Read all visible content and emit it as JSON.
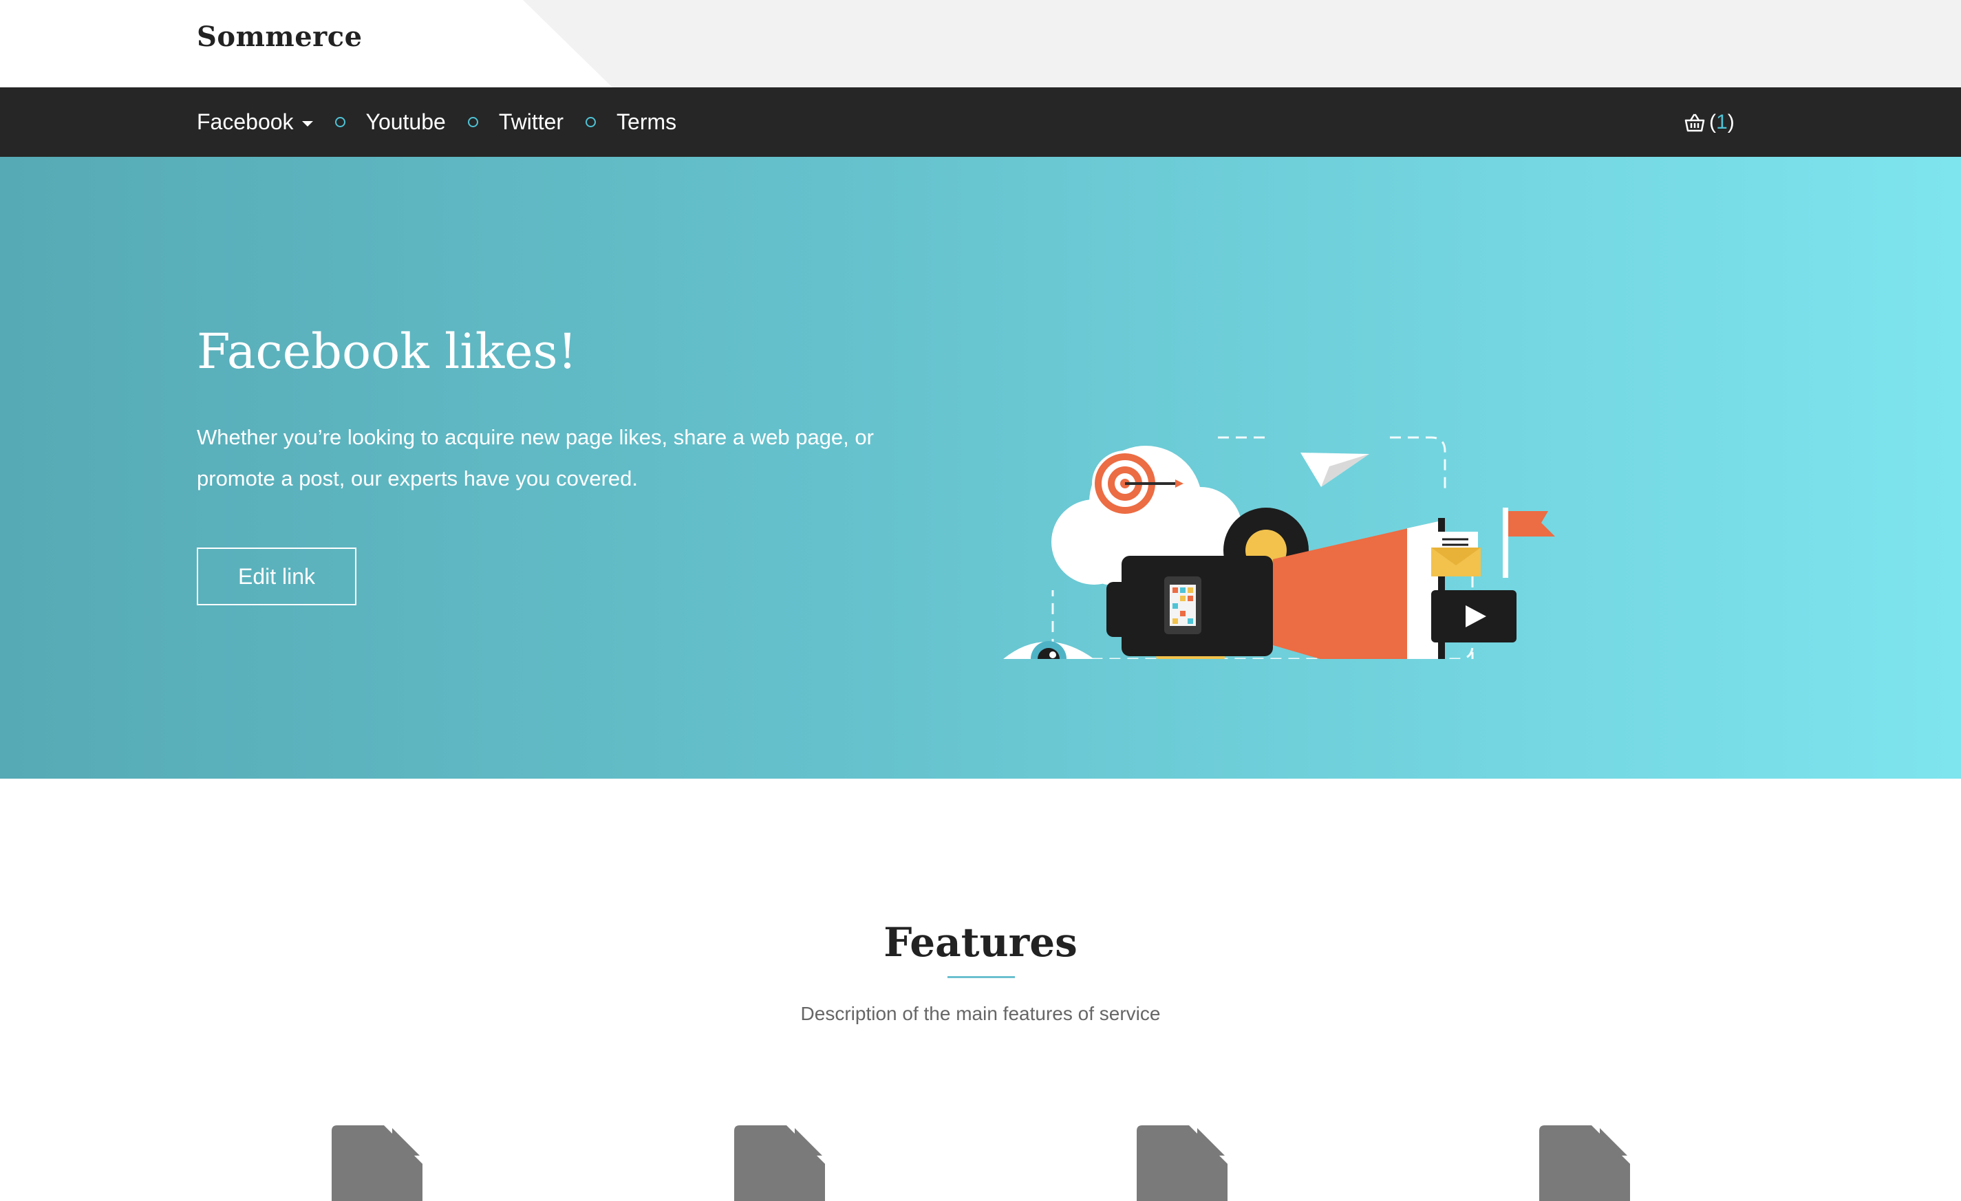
{
  "brand": {
    "name": "Sommerce"
  },
  "nav": {
    "items": [
      {
        "label": "Facebook",
        "dropdown": true
      },
      {
        "label": "Youtube"
      },
      {
        "label": "Twitter"
      },
      {
        "label": "Terms"
      }
    ],
    "cart": {
      "open": "(",
      "count": "1",
      "close": ")",
      "icon": "basket-icon"
    }
  },
  "hero": {
    "title": "Facebook likes!",
    "text": "Whether you’re looking to acquire new page likes, share a web page, or promote a post, our experts have you covered.",
    "button": "Edit link",
    "illustration": "megaphone-marketing-illustration"
  },
  "features": {
    "title": "Features",
    "subtitle": "Description of the main features of service",
    "icons": [
      "file-icon",
      "file-icon",
      "file-icon",
      "file-icon"
    ]
  },
  "colors": {
    "accent": "#4fc3d6",
    "navbar": "#262626",
    "hero_start": "#56aab5",
    "hero_end": "#7ee4ee"
  }
}
